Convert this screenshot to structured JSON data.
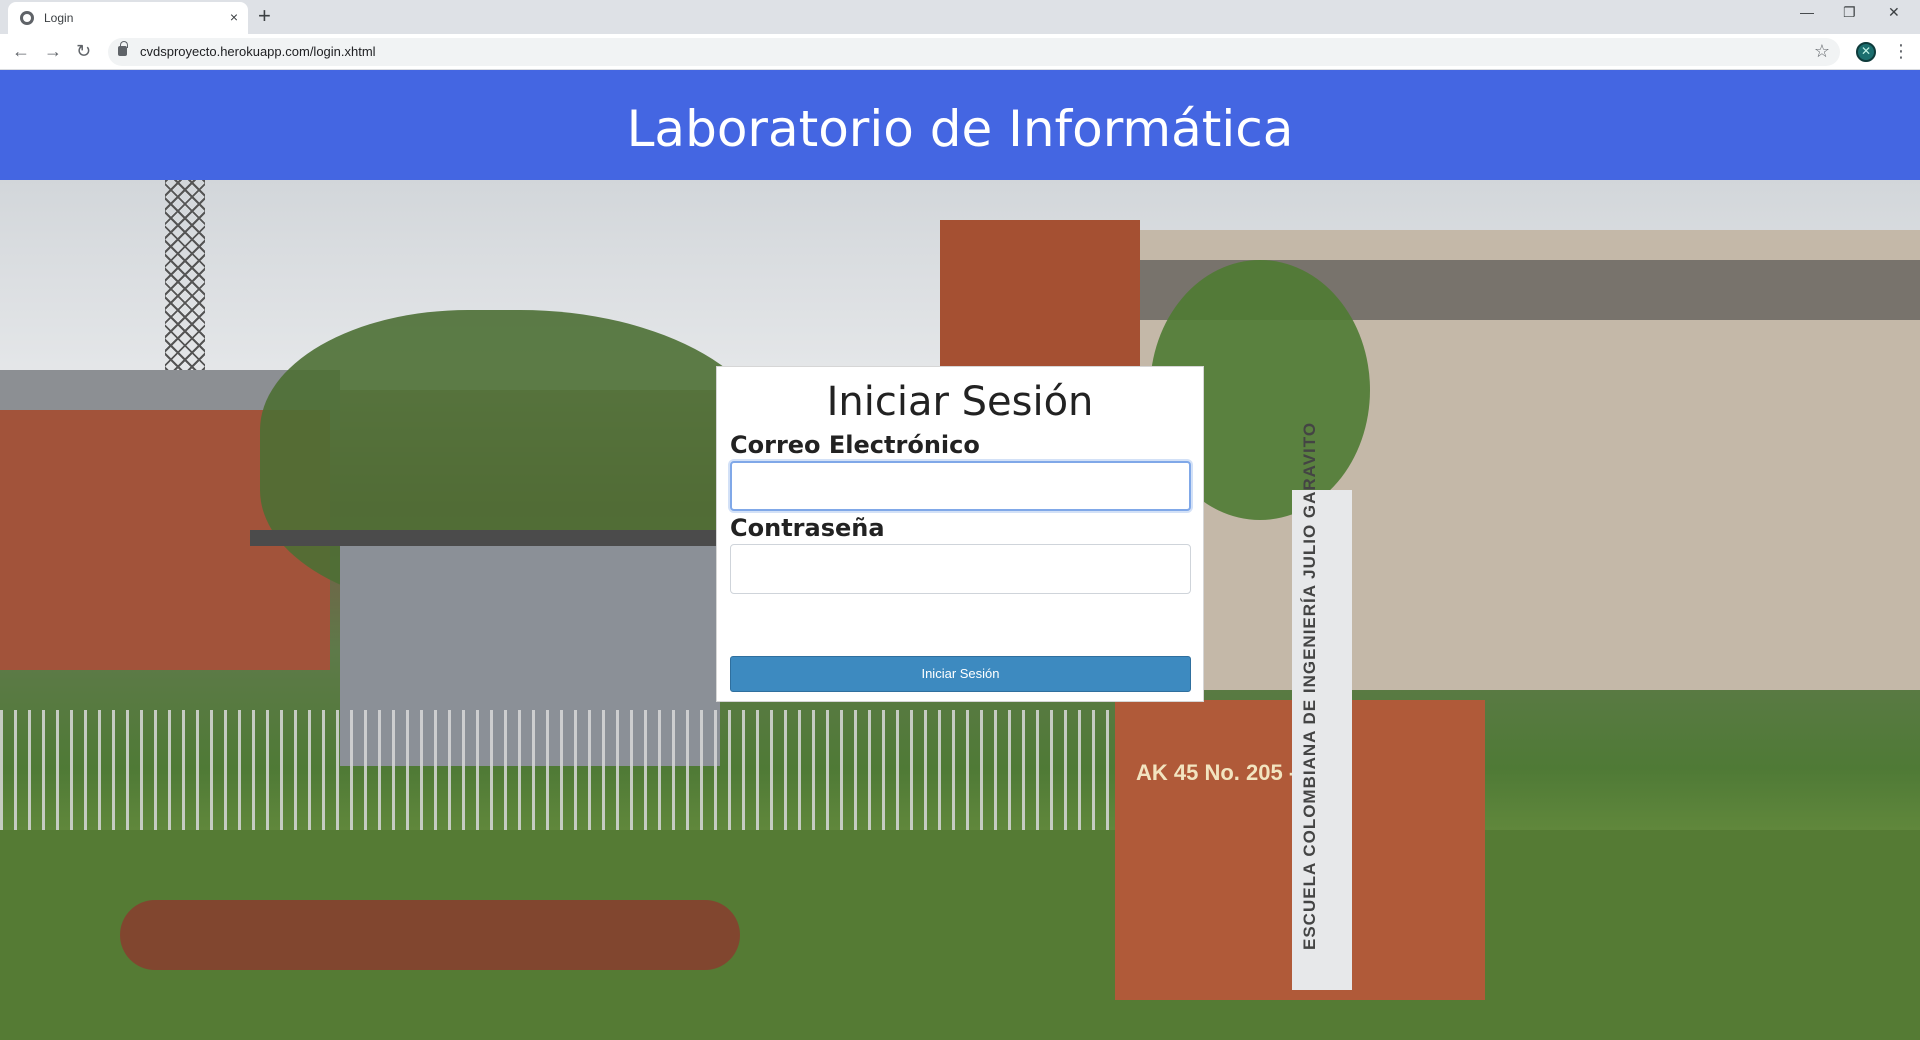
{
  "browser": {
    "tab_title": "Login",
    "tab_close": "×",
    "new_tab": "+",
    "url": "cvdsproyecto.herokuapp.com/login.xhtml",
    "back": "←",
    "forward": "→",
    "reload": "↻",
    "star": "☆",
    "menu": "⋮",
    "window_controls": {
      "minimize": "—",
      "restore": "❐",
      "close": "✕"
    }
  },
  "header": {
    "title": "Laboratorio de Informática"
  },
  "background": {
    "address_sign": "AK 45 No. 205 - 59",
    "totem_text": "ESCUELA COLOMBIANA DE INGENIERÍA JULIO GARAVITO"
  },
  "login": {
    "title": "Iniciar Sesión",
    "email_label": "Correo Electrónico",
    "email_value": "",
    "password_label": "Contraseña",
    "password_value": "",
    "submit_label": "Iniciar Sesión"
  },
  "colors": {
    "header_bg": "#4466e2",
    "button_bg": "#3d8ac0",
    "card_bg": "#ffffff"
  }
}
